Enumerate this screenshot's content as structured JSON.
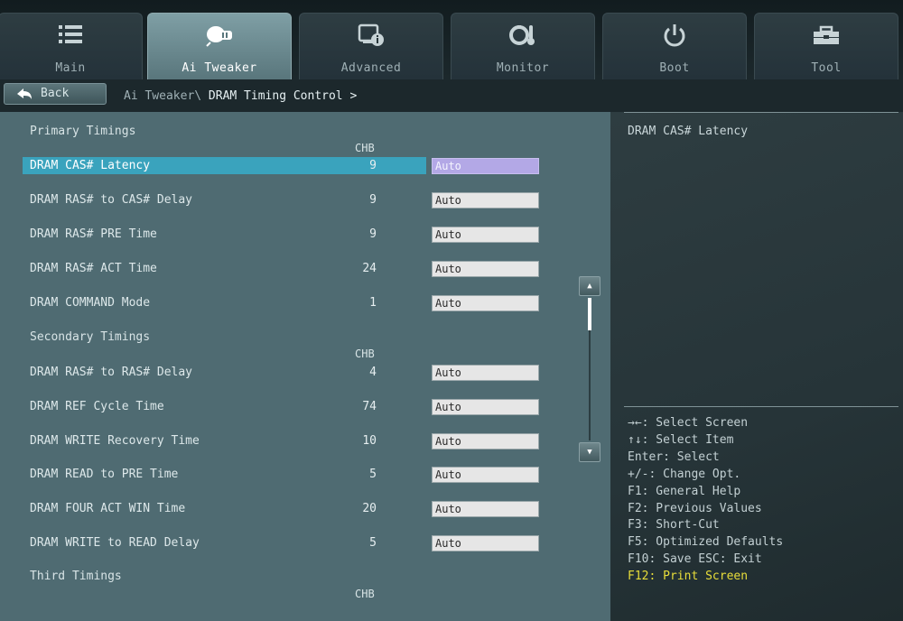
{
  "tabs": [
    {
      "label": "Main",
      "icon": "list-icon",
      "active": false
    },
    {
      "label": "Ai Tweaker",
      "icon": "ai-tweaker-icon",
      "active": true
    },
    {
      "label": "Advanced",
      "icon": "advanced-icon",
      "active": false
    },
    {
      "label": "Monitor",
      "icon": "monitor-icon",
      "active": false
    },
    {
      "label": "Boot",
      "icon": "power-icon",
      "active": false
    },
    {
      "label": "Tool",
      "icon": "tool-icon",
      "active": false
    }
  ],
  "back": {
    "label": "Back",
    "icon": "back-arrow-icon"
  },
  "breadcrumb": {
    "parent": "Ai Tweaker\\ ",
    "current": "DRAM Timing Control >"
  },
  "sections": {
    "primary": "Primary Timings",
    "secondary": "Secondary Timings",
    "third": "Third Timings",
    "chb": "CHB"
  },
  "rows": [
    {
      "label": "DRAM CAS# Latency",
      "value": "9",
      "setting": "Auto",
      "selected": true
    },
    {
      "label": "DRAM RAS# to CAS# Delay",
      "value": "9",
      "setting": "Auto"
    },
    {
      "label": "DRAM RAS# PRE Time",
      "value": "9",
      "setting": "Auto"
    },
    {
      "label": "DRAM RAS# ACT Time",
      "value": "24",
      "setting": "Auto"
    },
    {
      "label": "DRAM COMMAND Mode",
      "value": "1",
      "setting": "Auto"
    },
    {
      "label": "DRAM RAS# to RAS# Delay",
      "value": "4",
      "setting": "Auto"
    },
    {
      "label": "DRAM REF Cycle Time",
      "value": "74",
      "setting": "Auto"
    },
    {
      "label": "DRAM WRITE Recovery Time",
      "value": "10",
      "setting": "Auto"
    },
    {
      "label": "DRAM READ to PRE Time",
      "value": "5",
      "setting": "Auto"
    },
    {
      "label": "DRAM FOUR ACT WIN Time",
      "value": "20",
      "setting": "Auto"
    },
    {
      "label": "DRAM WRITE to READ Delay",
      "value": "5",
      "setting": "Auto"
    }
  ],
  "help": {
    "title": "DRAM CAS# Latency",
    "keys": [
      "→←: Select Screen",
      "↑↓: Select Item",
      "Enter: Select",
      "+/-: Change Opt.",
      "F1: General Help",
      "F2: Previous Values",
      "F3: Short-Cut",
      "F5: Optimized Defaults",
      "F10: Save  ESC: Exit",
      "F12: Print Screen"
    ]
  },
  "colors": {
    "accent": "#3aa3bd",
    "selected_input": "#b3a8e6",
    "f12_highlight": "#e9de3a"
  }
}
